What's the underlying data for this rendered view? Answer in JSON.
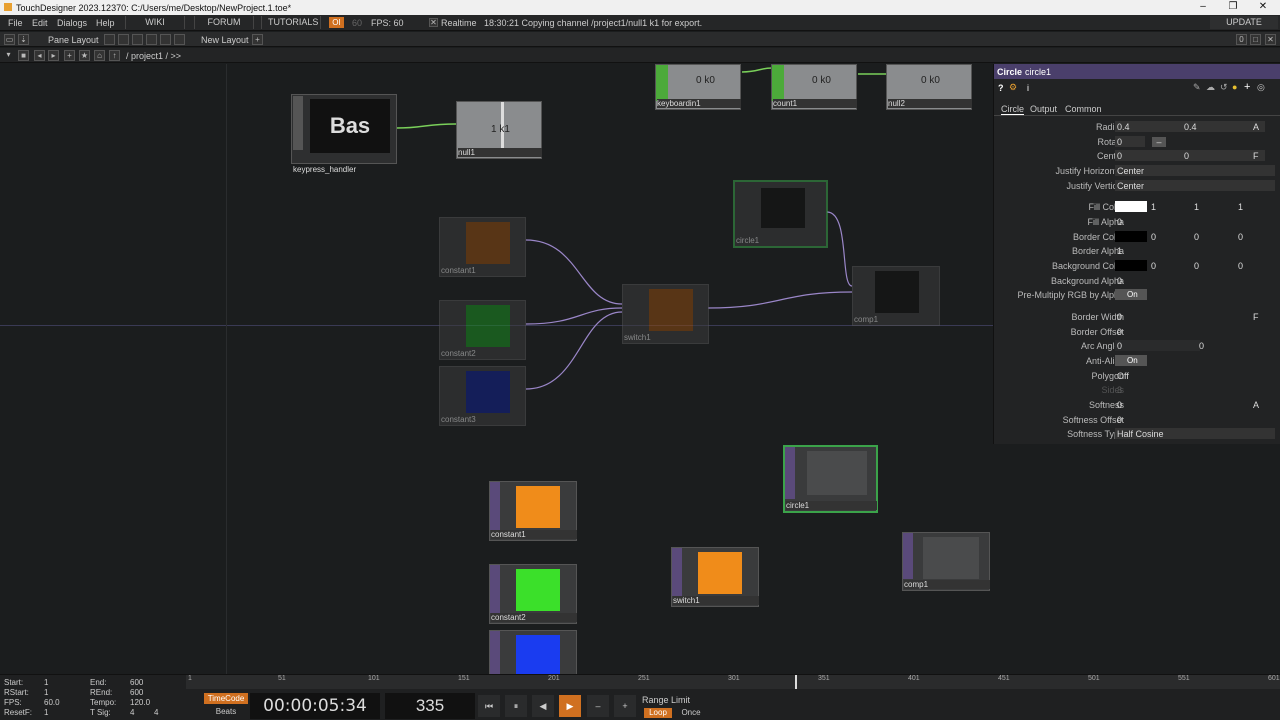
{
  "title": "TouchDesigner 2023.12370: C:/Users/me/Desktop/NewProject.1.toe*",
  "menu": {
    "file": "File",
    "edit": "Edit",
    "dialogs": "Dialogs",
    "help": "Help",
    "wiki": "WIKI",
    "forum": "FORUM",
    "tutorials": "TUTORIALS",
    "oi": "OI",
    "sixty": "60",
    "fps": "FPS:  60",
    "realtime": "Realtime",
    "status": "18:30:21 Copying channel /project1/null1 k1 for export.",
    "update": "UPDATE"
  },
  "bar2": {
    "pane_layout": "Pane Layout",
    "new_layout": "New Layout"
  },
  "bar3": {
    "path": "/ project1 / >>"
  },
  "nodes": {
    "keypress": {
      "label": "keypress_handler",
      "text": "Bas"
    },
    "null1": {
      "label": "null1",
      "text": "1 k1"
    },
    "keyboardin1": {
      "label": "keyboardin1",
      "text": "0 k0"
    },
    "count1": {
      "label": "count1",
      "text": "0 k0"
    },
    "null2": {
      "label": "null2",
      "text": "0 k0"
    },
    "circle1": {
      "label": "circle1"
    },
    "comp1": {
      "label": "comp1"
    },
    "constant1": {
      "label": "constant1"
    },
    "constant2": {
      "label": "constant2"
    },
    "constant3": {
      "label": "constant3"
    },
    "switch1": {
      "label": "switch1"
    }
  },
  "colors": {
    "orange": "#f08c1a",
    "green": "#3be02a",
    "blue": "#1a3cf0",
    "accent": "#3ba34a",
    "panel_head": "#4a3f6b"
  },
  "panel": {
    "type": "Circle",
    "name": "circle1",
    "tabs": [
      "Circle",
      "Output",
      "Common"
    ],
    "params": [
      {
        "label": "Radius",
        "value": "0.4",
        "value2": "0.4",
        "extra": "A"
      },
      {
        "label": "Rotate",
        "value": "0"
      },
      {
        "label": "Center",
        "value": "0",
        "value2": "0",
        "extra": "F"
      },
      {
        "label": "Justify Horizontal",
        "value": "Center"
      },
      {
        "label": "Justify Vertical",
        "value": "Center"
      },
      {
        "label": "Fill Color",
        "value": "1",
        "value2": "1",
        "value3": "1"
      },
      {
        "label": "Fill Alpha",
        "value": "0"
      },
      {
        "label": "Border Color",
        "value": "0",
        "value2": "0",
        "value3": "0"
      },
      {
        "label": "Border Alpha",
        "value": "1"
      },
      {
        "label": "Background Color",
        "value": "0",
        "value2": "0",
        "value3": "0"
      },
      {
        "label": "Background Alpha",
        "value": "0"
      },
      {
        "label": "Pre-Multiply RGB by Alpha",
        "value": "On"
      },
      {
        "label": "Border Width",
        "value": "0",
        "extra": "F"
      },
      {
        "label": "Border Offset",
        "value": "0"
      },
      {
        "label": "Arc Angles",
        "value": "0",
        "value2": "0"
      },
      {
        "label": "Anti-Alias",
        "value": "On"
      },
      {
        "label": "Polygon",
        "value": "Off"
      },
      {
        "label": "Sides",
        "value": "3"
      },
      {
        "label": "Softness",
        "value": "0",
        "extra": "A"
      },
      {
        "label": "Softness Offset",
        "value": "0"
      },
      {
        "label": "Softness Type",
        "value": "Half Cosine"
      }
    ]
  },
  "bottom": {
    "start_l": "Start:",
    "start_v": "1",
    "rstart_l": "RStart:",
    "rstart_v": "1",
    "fps_l": "FPS:",
    "fps_v": "60.0",
    "resetf_l": "ResetF:",
    "resetf_v": "1",
    "end_l": "End:",
    "end_v": "600",
    "rend_l": "REnd:",
    "rend_v": "600",
    "tempo_l": "Tempo:",
    "tempo_v": "120.0",
    "tsig_l": "T Sig:",
    "tsig_v1": "4",
    "tsig_v2": "4",
    "timecode": "TimeCode",
    "beats": "Beats",
    "tc_value": "00:00:05:34",
    "frame": "335",
    "range_limit": "Range Limit",
    "loop": "Loop",
    "once": "Once",
    "ticks": [
      "1",
      "51",
      "101",
      "151",
      "201",
      "251",
      "301",
      "351",
      "401",
      "451",
      "501",
      "551",
      "601"
    ]
  }
}
